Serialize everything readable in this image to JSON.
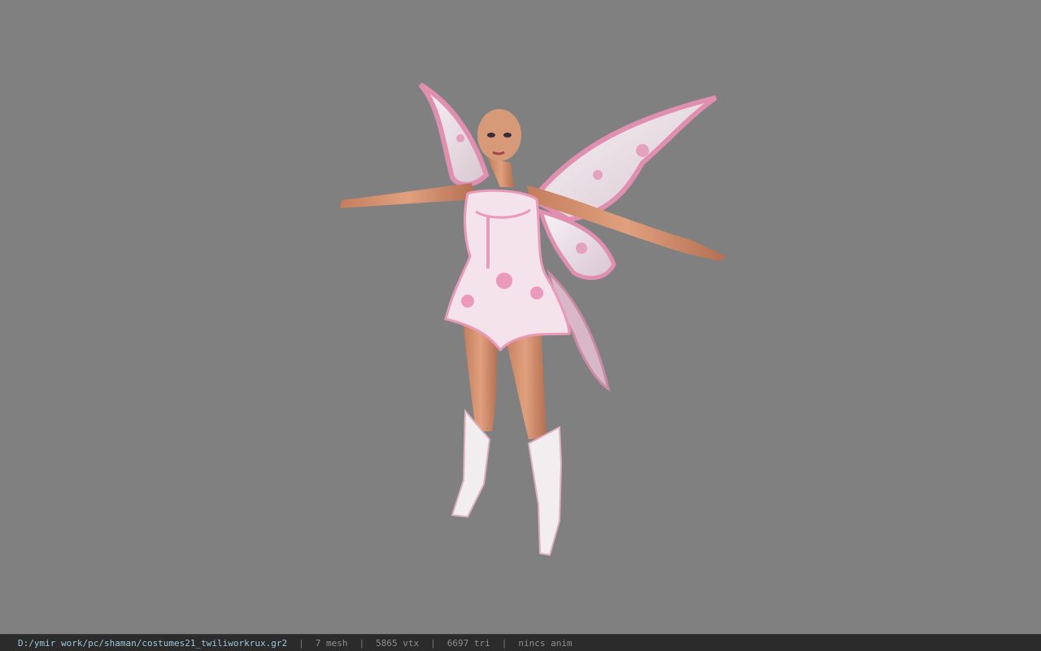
{
  "viewer": {
    "background_color": "#808080",
    "model_subject": "fairy-costume-character"
  },
  "status_bar": {
    "file_path": "D:/ymir work/pc/shaman/costumes21_twiliworkrux.gr2",
    "separator": "|",
    "mesh_count": "7 mesh",
    "vertex_count": "5865 vtx",
    "triangle_count": "6697 tri",
    "animation_status": "nincs anim"
  }
}
